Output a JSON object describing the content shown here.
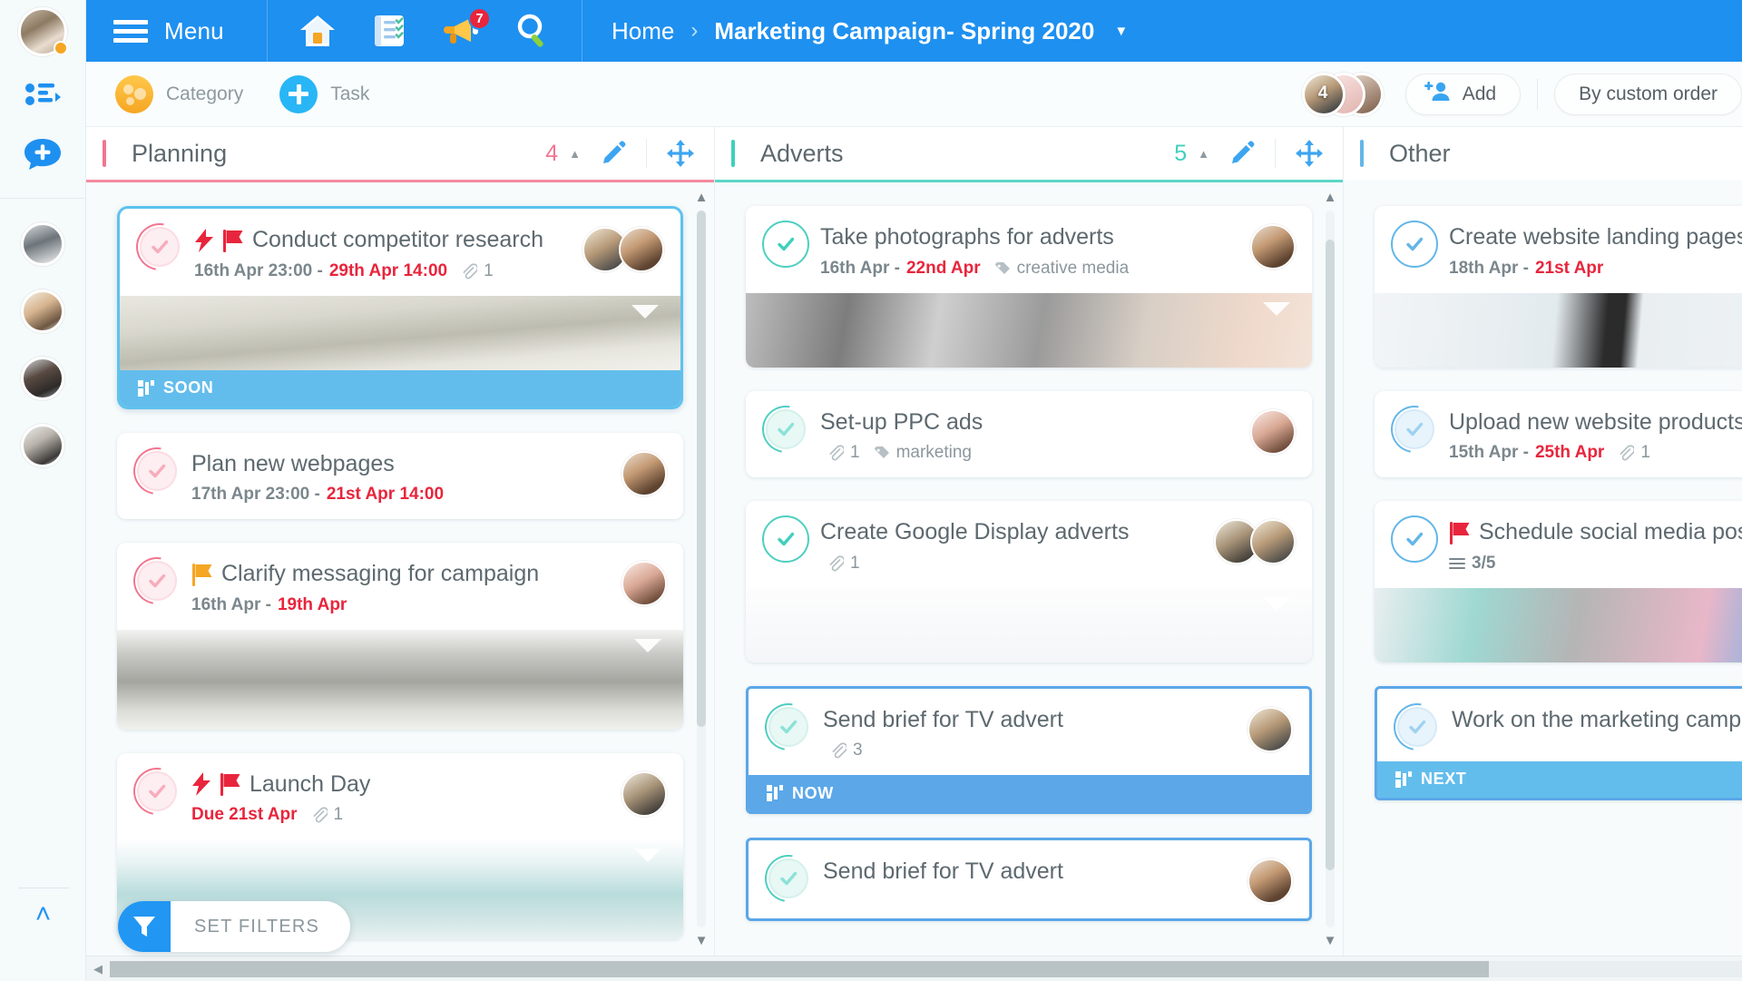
{
  "colors": {
    "brand_blue": "#1e90f0",
    "accent_pink": "#f2768f",
    "accent_teal": "#3fd0bd",
    "accent_blue": "#63b6e8",
    "due_red": "#e8253c",
    "ribbon_soon": "#63bdec",
    "ribbon_now": "#5ba7e8",
    "ribbon_next": "#63bdec"
  },
  "topbar": {
    "menu_label": "Menu",
    "icons": [
      {
        "name": "home-icon",
        "label": "Home"
      },
      {
        "name": "tasks-icon",
        "label": "Tasks"
      },
      {
        "name": "announcements-icon",
        "label": "Announcements",
        "badge": "7"
      },
      {
        "name": "search-icon",
        "label": "Search"
      }
    ],
    "notification_badge": "7",
    "breadcrumb": {
      "home": "Home",
      "separator": "›",
      "current": "Marketing Campaign- Spring 2020",
      "caret": "▼"
    }
  },
  "subbar": {
    "category_label": "Category",
    "task_label": "Task",
    "avatar_count": "4",
    "add_label": "Add",
    "sort_label": "By custom order"
  },
  "rail": {
    "items": [
      {
        "name": "rail-avatar-self",
        "label": "My profile"
      },
      {
        "name": "rail-list-icon",
        "label": "Lists"
      },
      {
        "name": "rail-chat-icon",
        "label": "New chat"
      },
      {
        "name": "rail-avatar-team",
        "label": "Team workspace"
      },
      {
        "name": "rail-avatar-person-1",
        "label": "Person 1"
      },
      {
        "name": "rail-avatar-person-2",
        "label": "Person 2"
      },
      {
        "name": "rail-avatar-person-3",
        "label": "Person 3"
      }
    ],
    "collapse_label": "˄"
  },
  "filters": {
    "label": "SET FILTERS"
  },
  "columns": [
    {
      "name": "planning",
      "title": "Planning",
      "count": "4",
      "accent": "#f2768f",
      "caret": "▲",
      "cards": [
        {
          "title": "Conduct competitor research",
          "flags": [
            "lightning",
            "flag-red"
          ],
          "date_start": "16th Apr 23:00 - ",
          "date_due": "29th Apr 14:00",
          "attachments": "1",
          "tag": "",
          "checklist": "",
          "avatars": 2,
          "image": true,
          "image_tall": false,
          "ribbon": "SOON",
          "ribbon_color": "#63bdec",
          "selected": true,
          "check_style": "pink"
        },
        {
          "title": "Plan new webpages",
          "flags": [],
          "date_start": "17th Apr 23:00 - ",
          "date_due": "21st Apr 14:00",
          "attachments": "",
          "tag": "",
          "checklist": "",
          "avatars": 1,
          "image": false,
          "ribbon": "",
          "selected": false,
          "check_style": "pink"
        },
        {
          "title": "Clarify messaging for campaign",
          "flags": [
            "flag-orange"
          ],
          "date_start": "16th Apr - ",
          "date_due": "19th Apr",
          "attachments": "",
          "tag": "",
          "checklist": "",
          "avatars": 1,
          "image": true,
          "image_tall": true,
          "ribbon": "",
          "selected": false,
          "check_style": "pink"
        },
        {
          "title": "Launch Day",
          "flags": [
            "lightning",
            "flag-red"
          ],
          "date_start": "",
          "date_due": "Due 21st Apr",
          "attachments": "1",
          "tag": "",
          "checklist": "",
          "avatars": 1,
          "image": true,
          "image_tall": true,
          "ribbon": "",
          "selected": false,
          "check_style": "pink"
        }
      ]
    },
    {
      "name": "adverts",
      "title": "Adverts",
      "count": "5",
      "accent": "#3fd0bd",
      "caret": "▲",
      "cards": [
        {
          "title": "Take photographs for adverts",
          "flags": [],
          "date_start": "16th Apr - ",
          "date_due": "22nd Apr",
          "attachments": "",
          "tag": "creative media",
          "checklist": "",
          "avatars": 1,
          "image": true,
          "image_tall": false,
          "ribbon": "",
          "selected": false,
          "check_style": "teal-full"
        },
        {
          "title": "Set-up PPC ads",
          "flags": [],
          "date_start": "",
          "date_due": "",
          "attachments": "1",
          "tag": "marketing",
          "checklist": "",
          "avatars": 1,
          "image": false,
          "ribbon": "",
          "selected": false,
          "check_style": "teal"
        },
        {
          "title": "Create Google Display adverts",
          "flags": [],
          "date_start": "",
          "date_due": "",
          "attachments": "1",
          "tag": "",
          "checklist": "",
          "avatars": 2,
          "image": true,
          "image_tall": false,
          "ribbon": "",
          "selected": false,
          "check_style": "teal-full"
        },
        {
          "title": "Send brief for TV advert",
          "flags": [],
          "date_start": "",
          "date_due": "",
          "attachments": "3",
          "tag": "",
          "checklist": "",
          "avatars": 1,
          "image": false,
          "ribbon": "NOW",
          "ribbon_color": "#5ba7e8",
          "selected": true,
          "check_style": "teal"
        },
        {
          "title": "Send brief for TV advert",
          "flags": [],
          "date_start": "",
          "date_due": "",
          "attachments": "",
          "tag": "",
          "checklist": "",
          "avatars": 1,
          "image": false,
          "ribbon": "",
          "selected": true,
          "check_style": "teal"
        }
      ]
    },
    {
      "name": "other",
      "title": "Other",
      "count": "",
      "accent": "#63b6e8",
      "caret": "",
      "cards": [
        {
          "title": "Create website landing pages",
          "flags": [],
          "date_start": "18th Apr - ",
          "date_due": "21st Apr",
          "attachments": "",
          "tag": "",
          "checklist": "",
          "avatars": 0,
          "image": true,
          "image_tall": false,
          "ribbon": "",
          "selected": false,
          "check_style": "blue-full"
        },
        {
          "title": "Upload new website products",
          "flags": [],
          "date_start": "15th Apr - ",
          "date_due": "25th Apr",
          "attachments": "1",
          "tag": "",
          "checklist": "",
          "avatars": 0,
          "image": false,
          "ribbon": "",
          "selected": false,
          "check_style": "blue"
        },
        {
          "title": "Schedule social media posts",
          "flags": [
            "flag-red"
          ],
          "date_start": "",
          "date_due": "",
          "attachments": "",
          "tag": "",
          "checklist": "3/5",
          "avatars": 0,
          "image": true,
          "image_tall": false,
          "ribbon": "",
          "selected": false,
          "check_style": "blue-full"
        },
        {
          "title": "Work on the marketing campaign",
          "flags": [],
          "date_start": "",
          "date_due": "",
          "attachments": "",
          "tag": "",
          "checklist": "",
          "avatars": 0,
          "image": false,
          "ribbon": "NEXT",
          "ribbon_color": "#63bdec",
          "selected": true,
          "check_style": "blue"
        }
      ]
    }
  ]
}
